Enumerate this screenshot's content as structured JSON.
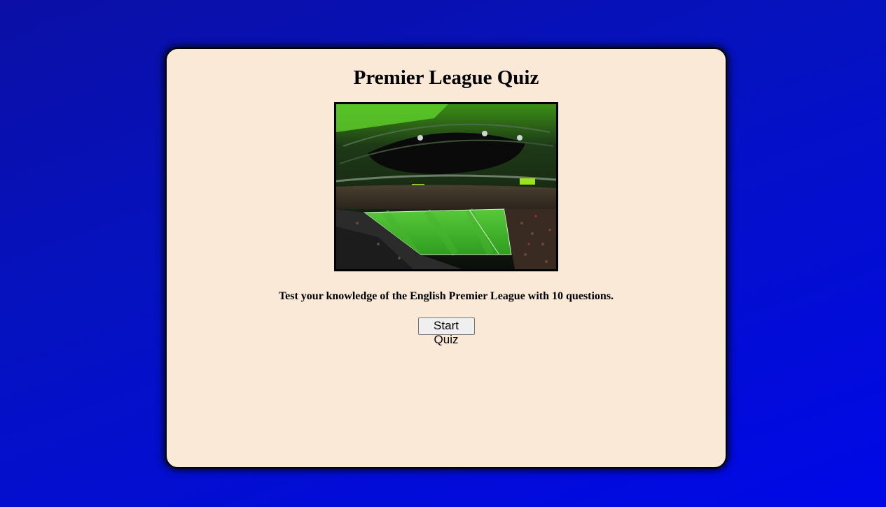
{
  "page": {
    "title": "Premier League Quiz",
    "description": "Test your knowledge of the English Premier League with 10 questions.",
    "start_button_label": "Start Quiz"
  },
  "image": {
    "alt": "Premier League Quiz"
  },
  "colors": {
    "background_top": "#0b0fa5",
    "background_bottom": "#0008e8",
    "card": "#f9e9d6",
    "pitch": "#3fb82b",
    "roof_light": "#56d51f"
  }
}
